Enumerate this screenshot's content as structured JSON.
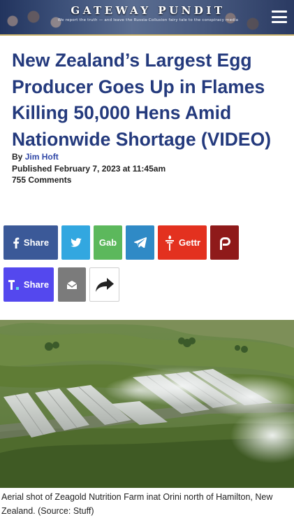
{
  "header": {
    "brand": "GATEWAY PUNDIT",
    "tagline": "We report the truth — and leave the Russia-Collusion fairy tale to the conspiracy media",
    "menu_icon": "hamburger-menu-icon"
  },
  "article": {
    "title": "New Zealand’s Largest Egg Producer Goes Up in Flames Killing 50,000 Hens Amid Nationwide Shortage (VIDEO)",
    "by_label": "By",
    "author": "Jim Hoft",
    "published_label": "Published",
    "published_date": "February 7, 2023 at 11:45am",
    "comments": "755 Comments"
  },
  "share": {
    "facebook_label": "Share",
    "gab_label": "Gab",
    "gettr_label": "Gettr",
    "truth_label": "Share",
    "icons": [
      "facebook-icon",
      "twitter-icon",
      "gab-icon",
      "telegram-icon",
      "gettr-icon",
      "parler-icon",
      "truth-social-icon",
      "email-icon",
      "share-arrow-icon"
    ],
    "colors": {
      "facebook": "#3b5998",
      "twitter": "#32a7e0",
      "gab": "#5cb85c",
      "telegram": "#2f8ac6",
      "gettr": "#e3311f",
      "parler": "#8f1a1a",
      "truth": "#5448ee",
      "email": "#7b7b7b"
    }
  },
  "photo": {
    "caption": "Aerial shot of Zeagold Nutrition Farm inat Orini north of Hamilton, New Zealand. (Source: Stuff)"
  },
  "colors": {
    "headline": "#243a7d",
    "author_link": "#2f47a6"
  }
}
